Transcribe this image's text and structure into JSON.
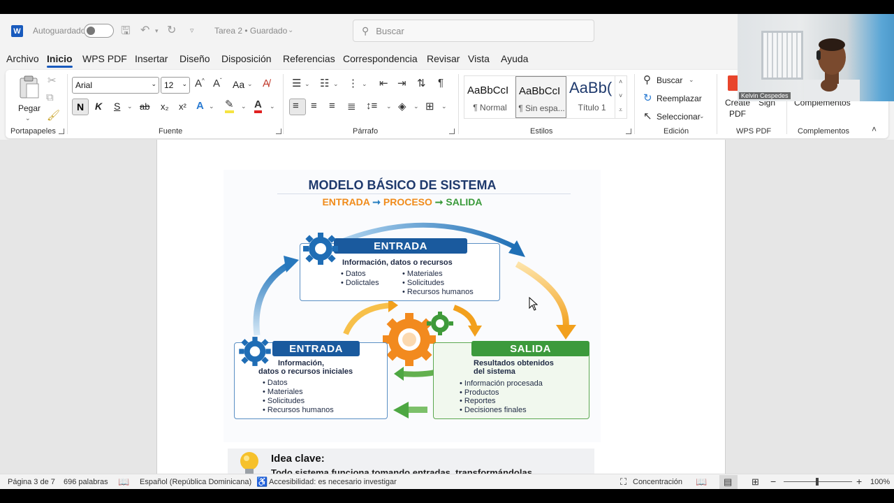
{
  "titlebar": {
    "app_badge": "W",
    "autosave_label": "Autoguardado",
    "document_title": "Tarea 2 • Guardado",
    "search_placeholder": "Buscar"
  },
  "menu": [
    "Archivo",
    "Inicio",
    "WPS PDF",
    "Insertar",
    "Diseño",
    "Disposición",
    "Referencias",
    "Correspondencia",
    "Revisar",
    "Vista",
    "Ayuda"
  ],
  "ribbon": {
    "clipboard": {
      "paste_label": "Pegar",
      "group_label": "Portapapeles"
    },
    "font": {
      "font_name": "Arial",
      "font_size": "12",
      "case_label": "Aa",
      "bold_label": "N",
      "italic_label": "K",
      "underline_label": "S",
      "strike_label": "ab",
      "sub_label": "x₂",
      "sup_label": "x²",
      "group_label": "Fuente"
    },
    "paragraph": {
      "group_label": "Párrafo"
    },
    "styles": {
      "items": [
        {
          "preview": "AaBbCcI",
          "name": "¶ Normal"
        },
        {
          "preview": "AaBbCcI",
          "name": "¶ Sin espa..."
        },
        {
          "preview": "AaBb(",
          "name": "Título 1"
        }
      ],
      "group_label": "Estilos"
    },
    "editing": {
      "find_label": "Buscar",
      "replace_label": "Reemplazar",
      "select_label": "Seleccionar",
      "group_label": "Edición"
    },
    "wps": {
      "create_label": "Create",
      "pdf_label": "PDF",
      "sign_label": "Sign",
      "group_label": "WPS PDF"
    },
    "addins": {
      "label": "Complementos",
      "group_label": "Complementos"
    }
  },
  "document": {
    "diagram": {
      "title": "MODELO BÁSICO DE SISTEMA",
      "flow": {
        "input": "ENTRADA",
        "arrow": "➞",
        "process": "PROCESO",
        "output": "SALIDA"
      },
      "top_card": {
        "header": "ENTRADA",
        "subtitle": "Información, datos o recursos",
        "col1": [
          "Datos",
          "Dolictales"
        ],
        "col2": [
          "Materiales",
          "Solicitudes",
          "Recursos humanos"
        ]
      },
      "left_card": {
        "header": "ENTRADA",
        "subtitle1": "Información,",
        "subtitle2": "datos o recursos iniciales",
        "items": [
          "Datos",
          "Materiales",
          "Solicitudes",
          "Recursos humanos"
        ]
      },
      "right_card": {
        "header": "SALIDA",
        "subtitle1": "Resultados obtenidos",
        "subtitle2": "del sistema",
        "items": [
          "Información procesada",
          "Productos",
          "Reportes",
          "Decisiones finales"
        ]
      }
    },
    "idea": {
      "title": "Idea clave:",
      "text": "Todo sistema funciona tomando entradas, transformándolas"
    }
  },
  "statusbar": {
    "page": "Página 3 de 7",
    "words": "696 palabras",
    "language": "Español (República Dominicana)",
    "accessibility": "Accesibilidad: es necesario investigar",
    "focus": "Concentración",
    "zoom": "100%"
  },
  "webcam": {
    "name": "Kelvin Cespedes"
  },
  "colors": {
    "word_blue": "#185abd",
    "entrada_blue": "#1a5a9e",
    "salida_green": "#3c9a3c",
    "process_orange": "#f08b1a"
  }
}
